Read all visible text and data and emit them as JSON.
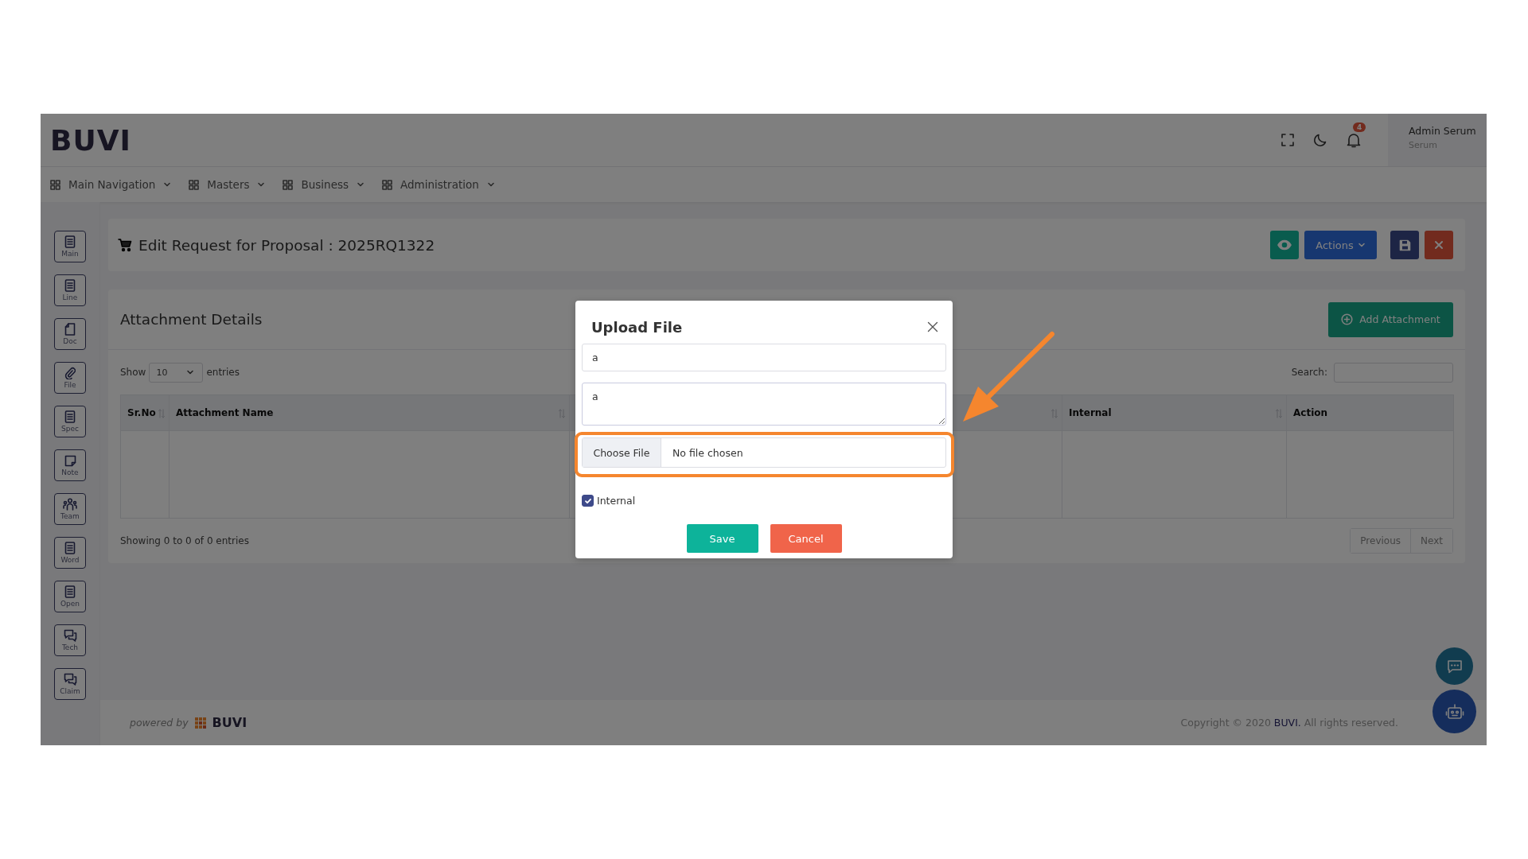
{
  "header": {
    "logo": "BUVI",
    "notification_count": "4",
    "user_name": "Admin Serum",
    "user_role": "Serum"
  },
  "nav": [
    {
      "label": "Main Navigation"
    },
    {
      "label": "Masters"
    },
    {
      "label": "Business"
    },
    {
      "label": "Administration"
    }
  ],
  "sidebar": [
    {
      "label": "Main",
      "kind": "list"
    },
    {
      "label": "Line",
      "kind": "list"
    },
    {
      "label": "Doc",
      "kind": "page"
    },
    {
      "label": "File",
      "kind": "clip"
    },
    {
      "label": "Spec",
      "kind": "list"
    },
    {
      "label": "Note",
      "kind": "note"
    },
    {
      "label": "Team",
      "kind": "team"
    },
    {
      "label": "Word",
      "kind": "list"
    },
    {
      "label": "Open",
      "kind": "list"
    },
    {
      "label": "Tech",
      "kind": "chat"
    },
    {
      "label": "Claim",
      "kind": "chat"
    }
  ],
  "page_title": "Edit Request for Proposal : 2025RQ1322",
  "toolbar": {
    "actions_label": "Actions"
  },
  "attachments": {
    "title": "Attachment Details",
    "add_button": "Add Attachment",
    "show_label": "Show",
    "page_size": "10",
    "entries_label": "entries",
    "search_label": "Search:",
    "columns": [
      {
        "label": "Sr.No",
        "sortable": true
      },
      {
        "label": "Attachment Name",
        "sortable": true
      },
      {
        "sortable": true
      },
      {
        "label": "Internal",
        "sortable": true
      },
      {
        "label": "Action",
        "sortable": false
      }
    ],
    "info": "Showing 0 to 0 of 0 entries",
    "pager": [
      "Previous",
      "Next"
    ]
  },
  "modal": {
    "title": "Upload File",
    "name_value": "a",
    "description_value": "a",
    "file_button": "Choose File",
    "file_status": "No file chosen",
    "internal": {
      "label": "Internal",
      "checked": true
    },
    "buttons": [
      {
        "label": "Save",
        "kind": "primary"
      },
      {
        "label": "Cancel",
        "kind": "danger"
      }
    ]
  },
  "footer": {
    "powered_by": "powered by",
    "brand": "BUVI",
    "copyright_before": "Copyright © 2020 ",
    "copyright_link": "BUVI.",
    "copyright_after": " All rights reserved."
  },
  "highlight": {
    "color": "#f5862e"
  },
  "arrow": {
    "color": "#f5862e"
  }
}
